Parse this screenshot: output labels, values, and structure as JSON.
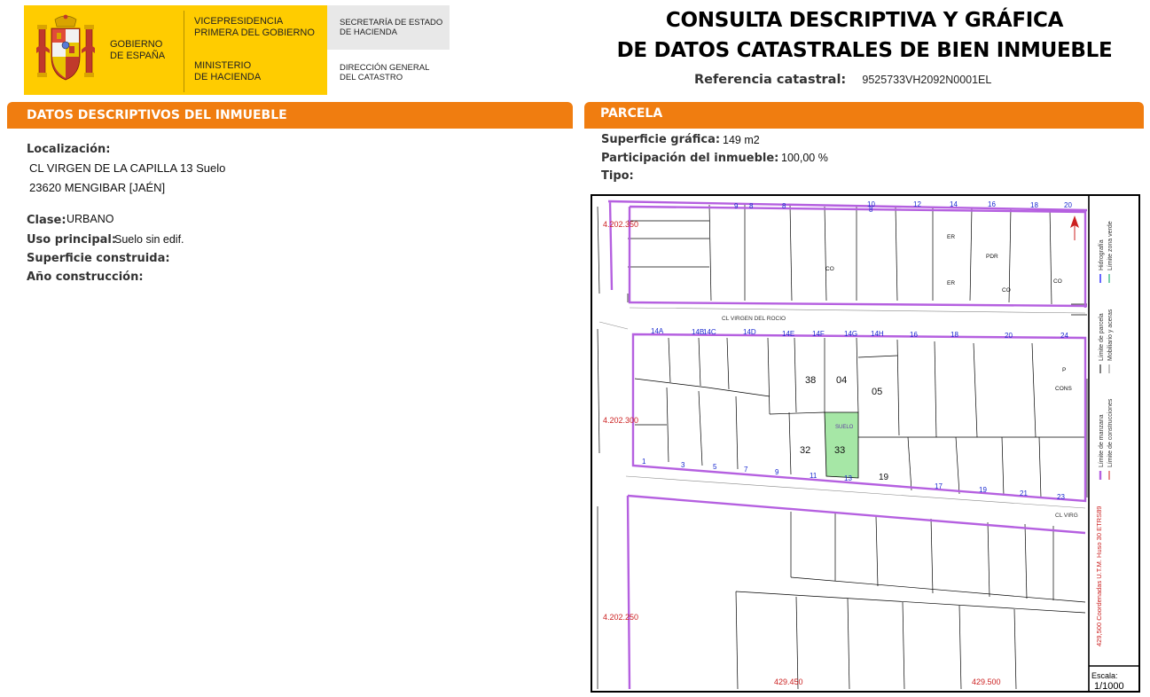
{
  "header": {
    "gov_label": "GOBIERNO\nDE ESPAÑA",
    "vice_label": "VICEPRESIDENCIA\nPRIMERA DEL GOBIERNO",
    "ministry_label": "MINISTERIO\nDE HACIENDA",
    "secretary_label": "SECRETARÍA DE ESTADO\nDE HACIENDA",
    "directorate_label": "DIRECCIÓN GENERAL\nDEL CATASTRO",
    "title_line1": "CONSULTA DESCRIPTIVA Y GRÁFICA",
    "title_line2": "DE DATOS CATASTRALES DE BIEN INMUEBLE",
    "ref_label": "Referencia catastral:",
    "ref_value": "9525733VH2092N0001EL"
  },
  "descriptive": {
    "section_title": "DATOS DESCRIPTIVOS DEL INMUEBLE",
    "location_label": "Localización:",
    "location_line1": "CL VIRGEN DE LA CAPILLA 13 Suelo",
    "location_line2": "23620 MENGIBAR [JAÉN]",
    "class_label": "Clase:",
    "class_value": "URBANO",
    "use_label": "Uso principal:",
    "use_value": "Suelo sin edif.",
    "built_area_label": "Superficie construida:",
    "year_label": "Año construcción:"
  },
  "parcel": {
    "section_title": "PARCELA",
    "graphic_area_label": "Superficie gráfica:",
    "graphic_area_value": "149 m2",
    "participation_label": "Participación del inmueble:",
    "participation_value": "100,00 %",
    "type_label": "Tipo:"
  },
  "map": {
    "coord_y_top": "4.202.350",
    "coord_y_mid": "4.202.300",
    "coord_y_bottom": "4.202.250",
    "coord_x_left": "429.450",
    "coord_x_right": "429.500",
    "street_top": "CL VIRGEN DEL ROCIO",
    "street_bottom": "CL VIRG",
    "parcel_labels": [
      "38",
      "04",
      "05",
      "32",
      "33"
    ],
    "target_use_label": "SUELO",
    "top_block_numbers": [
      "9",
      "8",
      "8",
      "10",
      "8",
      "12",
      "14",
      "16",
      "18",
      "20"
    ],
    "middle_top_numbers": [
      "14A",
      "14B",
      "14C",
      "14D",
      "14E",
      "14F",
      "14G",
      "14H",
      "16",
      "18",
      "20",
      "24"
    ],
    "middle_bottom_numbers": [
      "1",
      "3",
      "5",
      "7",
      "9",
      "11",
      "13",
      "19",
      "17",
      "19",
      "21",
      "23"
    ],
    "building_codes": [
      "CO",
      "ER",
      "ER",
      "PDR",
      "CO",
      "CO",
      "P",
      "CONS"
    ],
    "legend": {
      "manzana": "Límite de manzana",
      "parcela": "Límite de parcela",
      "hidrografia": "Hidrografía",
      "construcciones": "Límite de construcciones",
      "mobiliario": "Mobiliario y aceras",
      "zona_verde": "Límite zona verde",
      "coords_note": "429,500 Coordenadas U.T.M. Huso 30 ETRS89",
      "scale_label": "Escala:",
      "scale_value": "1/1000"
    }
  },
  "colors": {
    "banner_yellow": "#ffcc00",
    "section_orange": "#f07d10",
    "block_purple": "#b560e0",
    "selected_parcel_green": "#a6e7a6",
    "coord_red": "#cc2222"
  }
}
